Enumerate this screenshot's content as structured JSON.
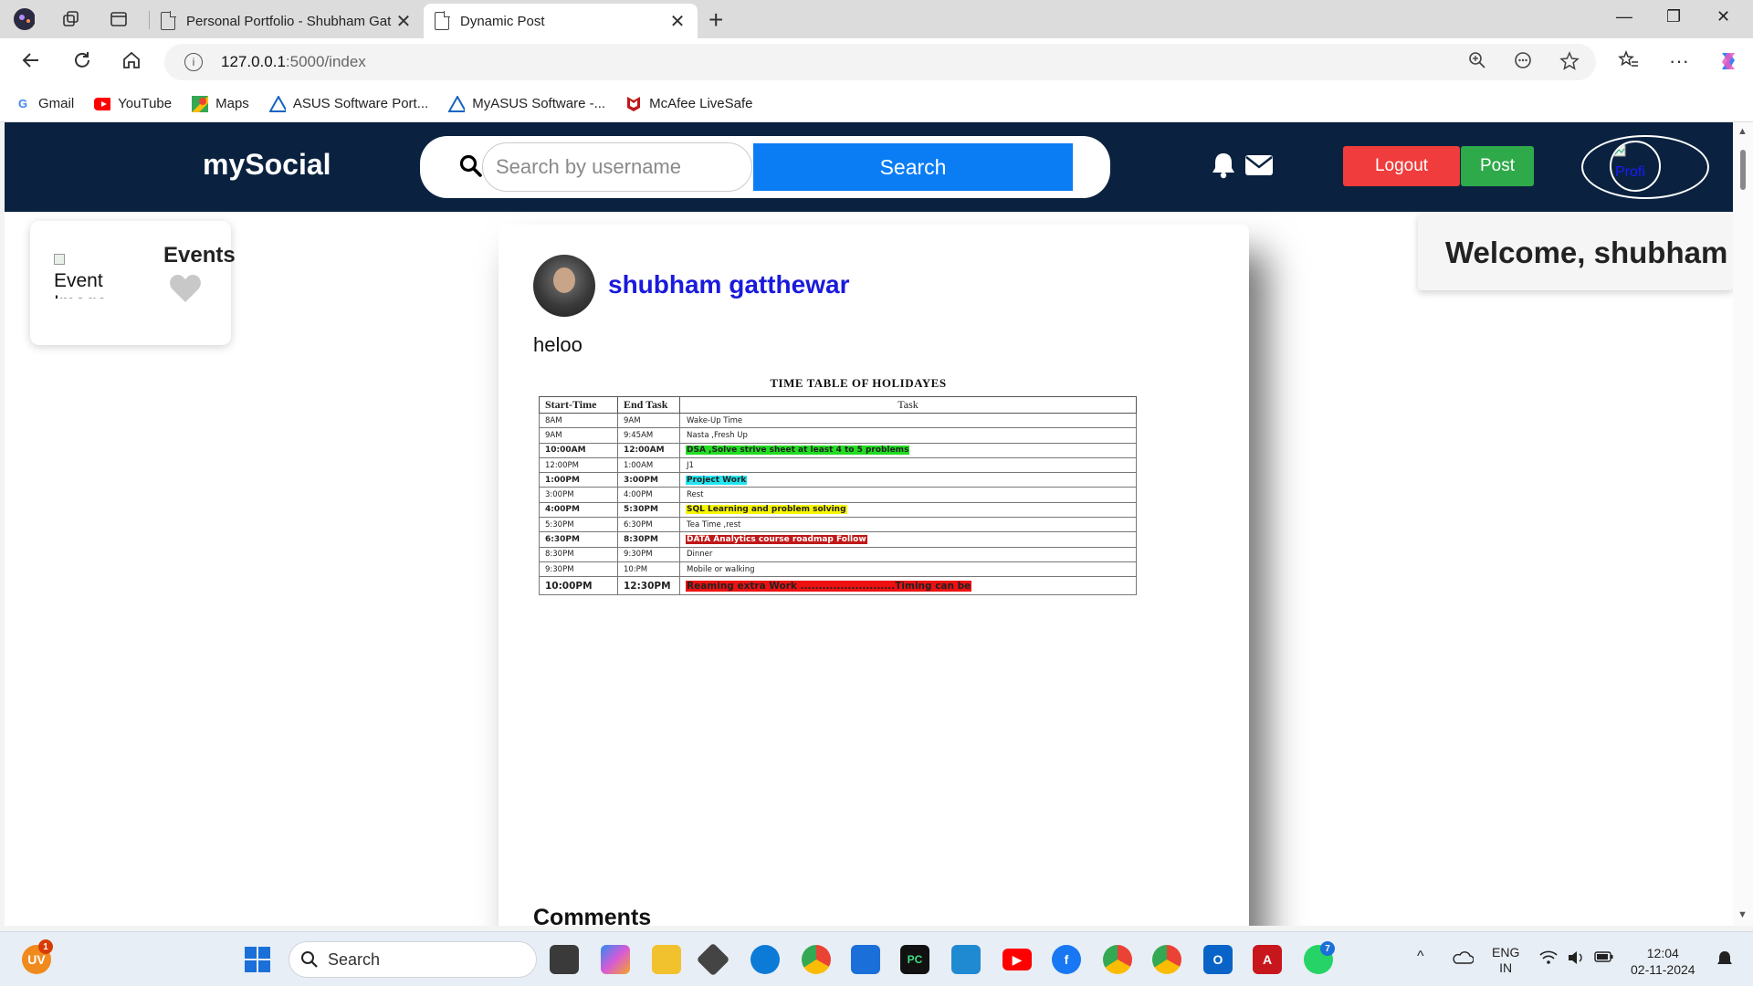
{
  "browser": {
    "tabs": [
      {
        "title": "Personal Portfolio - Shubham Gat",
        "active": false
      },
      {
        "title": "Dynamic Post",
        "active": true
      }
    ],
    "address": {
      "host": "127.0.0.1",
      "path": ":5000/index"
    },
    "bookmarks": [
      {
        "label": "Gmail",
        "icon": "google-icon",
        "color": "#4285f4"
      },
      {
        "label": "YouTube",
        "icon": "youtube-icon",
        "color": "#ff0000"
      },
      {
        "label": "Maps",
        "icon": "maps-icon",
        "color": "#34a853"
      },
      {
        "label": "ASUS Software Port...",
        "icon": "asus-icon",
        "color": "#1565c0"
      },
      {
        "label": "MyASUS Software -...",
        "icon": "myasus-icon",
        "color": "#1565c0"
      },
      {
        "label": "McAfee LiveSafe",
        "icon": "mcafee-icon",
        "color": "#c01818"
      }
    ]
  },
  "app": {
    "logo": "mySocial",
    "search": {
      "placeholder": "Search by username",
      "button": "Search"
    },
    "logout": "Logout",
    "post": "Post",
    "profile_alt": "Profi",
    "welcome": "Welcome, shubham",
    "events": {
      "title": "Events",
      "img_alt": "Event Image"
    }
  },
  "post": {
    "author": "shubham gatthewar",
    "text": "heloo",
    "comments_heading": "Comments",
    "image": {
      "title": "TIME TABLE OF HOLIDAYES",
      "headers": [
        "Start-Time",
        "End Task",
        "Task"
      ],
      "rows": [
        {
          "start": "8AM",
          "end": "9AM",
          "task": "Wake-Up Time",
          "style": "",
          "hl": ""
        },
        {
          "start": "9AM",
          "end": "9:45AM",
          "task": "Nasta ,Fresh Up",
          "style": "",
          "hl": ""
        },
        {
          "start": "10:00AM",
          "end": "12:00AM",
          "task": "DSA ,Solve strive sheet at least 4 to 5 problems",
          "style": "bold",
          "hl": "#22dd22"
        },
        {
          "start": "12:00PM",
          "end": "1:00AM",
          "task": "J1",
          "style": "",
          "hl": ""
        },
        {
          "start": "1:00PM",
          "end": "3:00PM",
          "task": "Project Work",
          "style": "bold",
          "hl": "#22e5f0"
        },
        {
          "start": "3:00PM",
          "end": "4:00PM",
          "task": "Rest",
          "style": "",
          "hl": ""
        },
        {
          "start": "4:00PM",
          "end": "5:30PM",
          "task": "SQL Learning and problem solving",
          "style": "bold",
          "hl": "#f5f500"
        },
        {
          "start": "5:30PM",
          "end": "6:30PM",
          "task": "Tea Time ,rest",
          "style": "",
          "hl": ""
        },
        {
          "start": "6:30PM",
          "end": "8:30PM",
          "task": "DATA Analytics course roadmap Follow",
          "style": "bold",
          "hl": "#c01818"
        },
        {
          "start": "8:30PM",
          "end": "9:30PM",
          "task": "Dinner",
          "style": "",
          "hl": ""
        },
        {
          "start": "9:30PM",
          "end": "10:PM",
          "task": "Mobile or walking",
          "style": "",
          "hl": ""
        },
        {
          "start": "10:00PM",
          "end": "12:30PM",
          "task": "Reaming extra Work ..........................Timing can be",
          "style": "big",
          "hl": "#ee1111"
        }
      ]
    }
  },
  "taskbar": {
    "search": "Search",
    "notification_count": "1",
    "whatsapp_count": "7",
    "lang": "ENG",
    "region": "IN",
    "time": "12:04",
    "date": "02-11-2024"
  }
}
